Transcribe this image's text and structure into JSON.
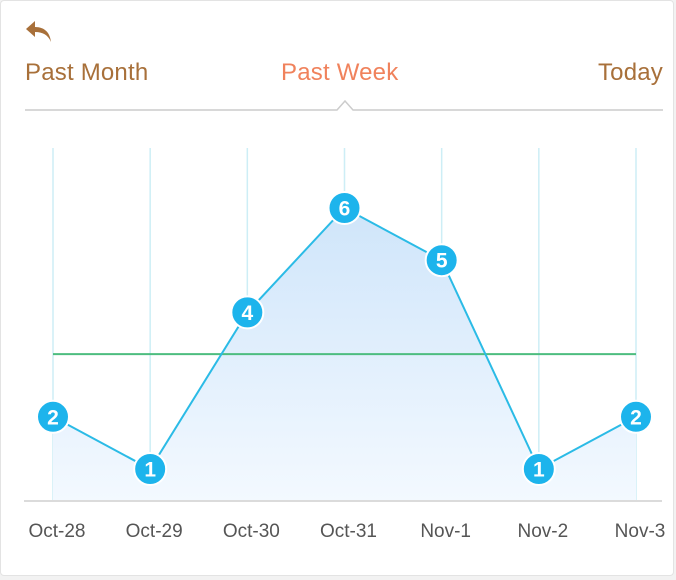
{
  "header": {
    "back_icon": "back-arrow-icon",
    "tabs": [
      {
        "label": "Past Month",
        "active": false
      },
      {
        "label": "Past Week",
        "active": true
      },
      {
        "label": "Today",
        "active": false
      }
    ]
  },
  "colors": {
    "tab_inactive": "#a8703a",
    "tab_active": "#f0825c",
    "line": "#2bbbe6",
    "point": "#1db4ec",
    "area_top": "#cfe5fa",
    "area_bottom": "#f3f9ff",
    "average_line": "#4dbd7f",
    "gridline": "#cdeef6",
    "baseline": "#cfcfcf"
  },
  "chart_data": {
    "type": "area",
    "categories": [
      "Oct-28",
      "Oct-29",
      "Oct-30",
      "Oct-31",
      "Nov-1",
      "Nov-2",
      "Nov-3"
    ],
    "series": [
      {
        "values": [
          2,
          1,
          4,
          6,
          5,
          1,
          2
        ]
      }
    ],
    "average": 3.2,
    "ylim": [
      0,
      7.5
    ],
    "grid": "vertical",
    "show_point_labels": true
  }
}
